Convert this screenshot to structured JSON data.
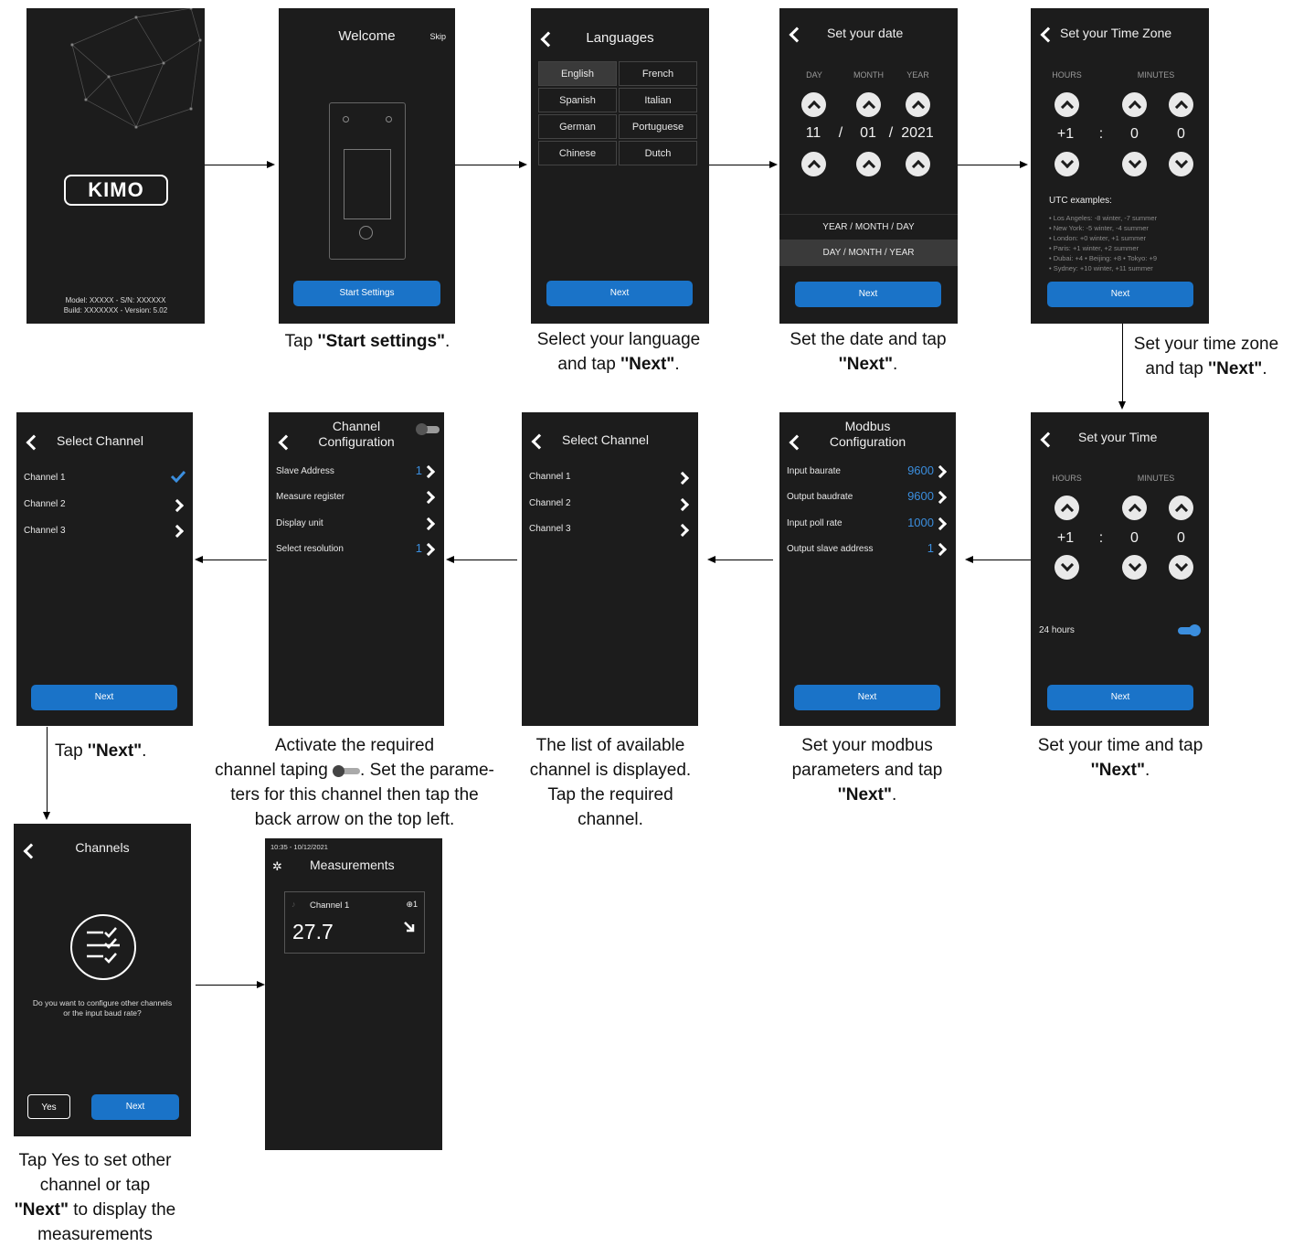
{
  "s1": {
    "logo": "KIMO",
    "footer_line1": "Model: XXXXX - S/N: XXXXXX",
    "footer_line2": "Build: XXXXXXX - Version: 5.02"
  },
  "s2": {
    "title": "Welcome",
    "skip": "Skip",
    "button": "Start Settings"
  },
  "s3": {
    "title": "Languages",
    "languages": [
      "English",
      "French",
      "Spanish",
      "Italian",
      "German",
      "Portuguese",
      "Chinese",
      "Dutch"
    ],
    "button": "Next"
  },
  "s4": {
    "title": "Set your date",
    "day_label": "DAY",
    "month_label": "MONTH",
    "year_label": "YEAR",
    "day": "11",
    "sep1": "/",
    "month": "01",
    "sep2": "/",
    "year": "2021",
    "format1": "YEAR / MONTH / DAY",
    "format2": "DAY / MONTH / YEAR",
    "button": "Next"
  },
  "s5": {
    "title": "Set your Time Zone",
    "hours_label": "HOURS",
    "minutes_label": "MINUTES",
    "hours": "+1",
    "colon": ":",
    "min1": "0",
    "min2": "0",
    "utc_title": "UTC examples:",
    "utc_lines": [
      "• Los Angeles: -8 winter, -7 summer",
      "• New York: -5 winter, -4 summer",
      "• London: +0 winter, +1 summer",
      "• Paris: +1 winter, +2 summer",
      "• Dubai: +4  • Beijing: +8  • Tokyo: +9",
      "• Sydney: +10 winter, +11 summer"
    ],
    "button": "Next"
  },
  "s6": {
    "title": "Set your Time",
    "hours_label": "HOURS",
    "minutes_label": "MINUTES",
    "hours": "+1",
    "colon": ":",
    "min1": "0",
    "min2": "0",
    "toggle_label": "24 hours",
    "button": "Next"
  },
  "s7": {
    "title_line1": "Modbus",
    "title_line2": "Configuration",
    "rows": [
      {
        "label": "Input baurate",
        "value": "9600"
      },
      {
        "label": "Output baudrate",
        "value": "9600"
      },
      {
        "label": "Input poll rate",
        "value": "1000"
      },
      {
        "label": "Output slave address",
        "value": "1"
      }
    ],
    "button": "Next"
  },
  "s8": {
    "title": "Select Channel",
    "rows": [
      "Channel 1",
      "Channel 2",
      "Channel 3"
    ]
  },
  "s9": {
    "title_line1": "Channel",
    "title_line2": "Configuration",
    "rows": [
      {
        "label": "Slave Address",
        "value": "1"
      },
      {
        "label": "Measure register",
        "value": ""
      },
      {
        "label": "Display unit",
        "value": ""
      },
      {
        "label": "Select resolution",
        "value": "1"
      }
    ]
  },
  "s10": {
    "title": "Select Channel",
    "rows": [
      "Channel 1",
      "Channel 2",
      "Channel 3"
    ],
    "button": "Next"
  },
  "s11": {
    "title": "Channels",
    "question_line1": "Do you want to configure other channels",
    "question_line2": "or the input baud rate?",
    "yes": "Yes",
    "button": "Next"
  },
  "s12": {
    "datetime": "10:35 - 10/12/2021",
    "title": "Measurements",
    "channel": "Channel 1",
    "value": "27.7"
  },
  "captions": {
    "c2": {
      "pre": "Tap ",
      "bold": "''Start settings\"",
      "post": "."
    },
    "c3": {
      "line1": "Select your language",
      "pre": "and tap ",
      "bold": "''Next\"",
      "post": "."
    },
    "c4": {
      "line1": "Set the date and tap",
      "bold": "''Next\"",
      "post": "."
    },
    "c5": {
      "line1": "Set your time zone",
      "pre": "and tap ",
      "bold": "''Next\"",
      "post": "."
    },
    "c6": {
      "line1": "Set your time and tap",
      "bold": "''Next\"",
      "post": "."
    },
    "c7": {
      "line1": "Set your modbus",
      "line2": "parameters and tap",
      "bold": "''Next\"",
      "post": "."
    },
    "c8": {
      "line1": "The list of available",
      "line2": "channel is displayed.",
      "line3": "Tap the required",
      "line4": "channel."
    },
    "c9": {
      "line1": "Activate the required",
      "line2a": "channel taping ",
      "line2b": ". Set the parame-",
      "line3": "ters for  this channel then tap the",
      "line4": "back arrow on the top left."
    },
    "c10": {
      "pre": "Tap ",
      "bold": "''Next\"",
      "post": "."
    },
    "c11": {
      "line1": "Tap Yes to set other",
      "line2": "channel or tap",
      "bold": "''Next\"",
      "post3": " to display the",
      "line4": "measurements"
    }
  }
}
